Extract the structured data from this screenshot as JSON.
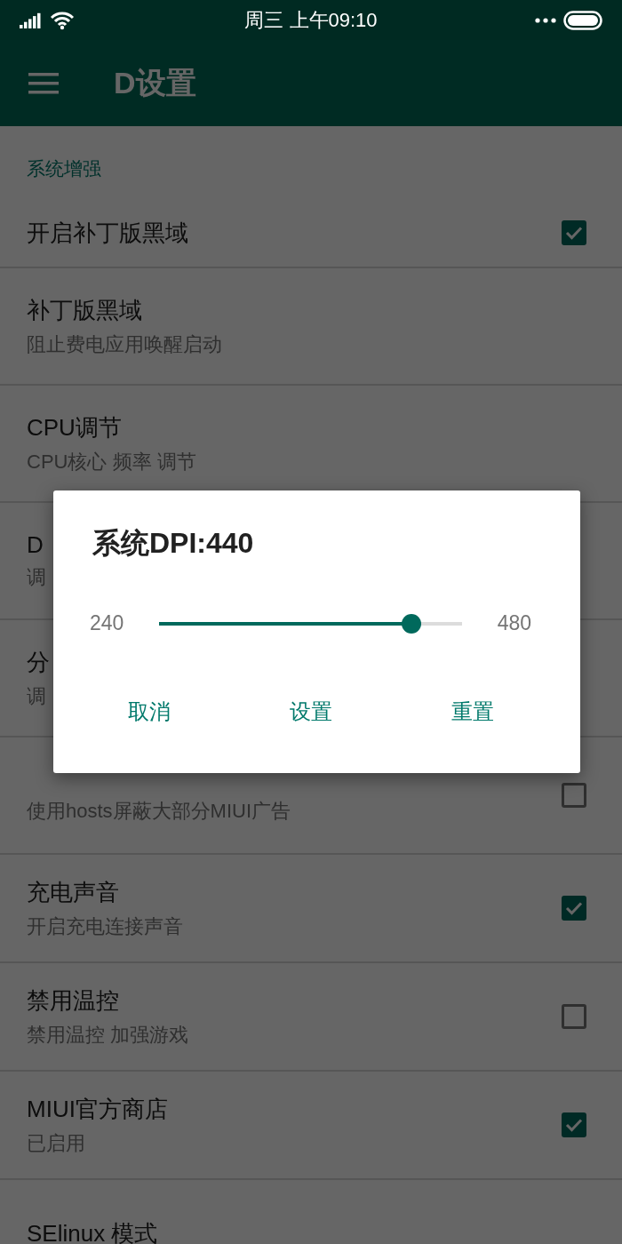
{
  "status_bar": {
    "time": "周三  上午09:10"
  },
  "app_bar": {
    "title": "D设置"
  },
  "section": {
    "title": "系统增强"
  },
  "items": [
    {
      "kind": "checkbox",
      "title": "开启补丁版黑域",
      "checked": true
    },
    {
      "kind": "plain",
      "title": "补丁版黑域",
      "subtitle": "阻止费电应用唤醒启动"
    },
    {
      "kind": "plain",
      "title": "CPU调节",
      "subtitle": "CPU核心 频率 调节"
    },
    {
      "kind": "plain",
      "title": "D",
      "subtitle": "调"
    },
    {
      "kind": "plain",
      "title": "分",
      "subtitle": "调"
    },
    {
      "kind": "checkbox",
      "subtitle": "使用hosts屏蔽大部分MIUI广告",
      "checked": false
    },
    {
      "kind": "checkbox",
      "title": "充电声音",
      "subtitle": "开启充电连接声音",
      "checked": true
    },
    {
      "kind": "checkbox",
      "title": "禁用温控",
      "subtitle": "禁用温控 加强游戏",
      "checked": false
    },
    {
      "kind": "checkbox",
      "title": "MIUI官方商店",
      "subtitle": "已启用",
      "checked": true
    },
    {
      "kind": "plain",
      "title": "SElinux 模式"
    }
  ],
  "dialog": {
    "title": "系统DPI:440",
    "min": "240",
    "max": "480",
    "level": 0.833,
    "buttons": [
      "取消",
      "设置",
      "重置"
    ]
  }
}
